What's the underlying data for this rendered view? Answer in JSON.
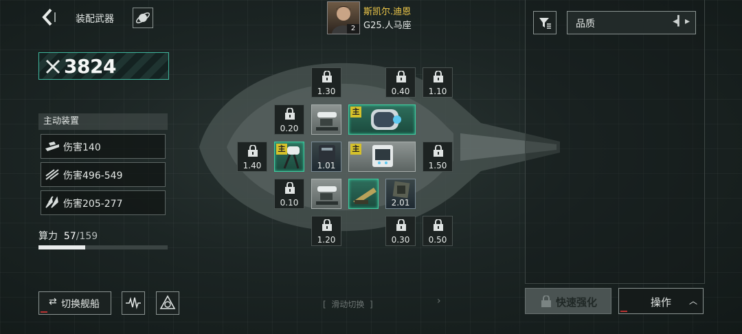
{
  "header": {
    "title": "装配武器"
  },
  "power": {
    "value": "3824"
  },
  "captain": {
    "name": "斯凯尔.迪恩",
    "level": "2",
    "ship": "G25.人马座"
  },
  "devices": {
    "title": "主动装置",
    "items": [
      {
        "label": "伤害140",
        "icon": "battleship-icon"
      },
      {
        "label": "伤害496-549",
        "icon": "triple-slash-icon"
      },
      {
        "label": "伤害205-277",
        "icon": "fighter-squad-icon"
      }
    ]
  },
  "compute": {
    "label": "算力",
    "used": "57",
    "total": "/159",
    "fill": 0.36
  },
  "slots": {
    "locked": [
      "1.30",
      "0.40",
      "1.10",
      "0.20",
      "1.40",
      "1.50",
      "0.10",
      "1.20",
      "0.30",
      "0.50"
    ],
    "equipped": [
      "1.01",
      "2.01"
    ],
    "main_tag": "主"
  },
  "filter": {
    "quality": "品质"
  },
  "bottom": {
    "switch_ship": "切换舰船",
    "swipe": "滑动切换",
    "quick_enhance": "快速强化",
    "operations": "操作"
  },
  "colors": {
    "accent": "#3fb79e",
    "main_tag": "#d6c12a",
    "captain_name": "#f0c94a"
  }
}
